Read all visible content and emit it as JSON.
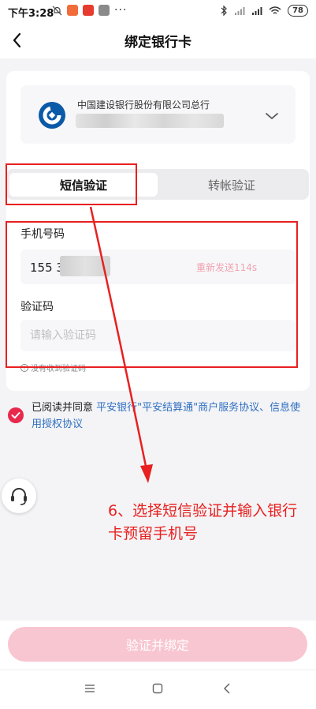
{
  "status_bar": {
    "time": "下午3:28",
    "dots": "···",
    "battery": "78"
  },
  "header": {
    "title": "绑定银行卡"
  },
  "bank": {
    "name": "中国建设银行股份有限公司总行"
  },
  "tabs": [
    {
      "label": "短信验证"
    },
    {
      "label": "转帐验证"
    }
  ],
  "phone": {
    "label": "手机号码",
    "value": "155 3",
    "resend": "重新发送114s"
  },
  "code": {
    "label": "验证码",
    "placeholder": "请输入验证码",
    "no_code": "没有收到验证码"
  },
  "agreement": {
    "prefix": "已阅读并同意",
    "link": "平安银行\"平安结算通\"商户服务协议、信息使用授权协议"
  },
  "annotation": {
    "text": "6、选择短信验证并输入银行卡预留手机号"
  },
  "submit": {
    "label": "验证并绑定"
  },
  "colors": {
    "accent": "#e8294c",
    "annotation": "#e82020",
    "button_disabled": "#f8c6d1",
    "link": "#2f6fc0"
  }
}
